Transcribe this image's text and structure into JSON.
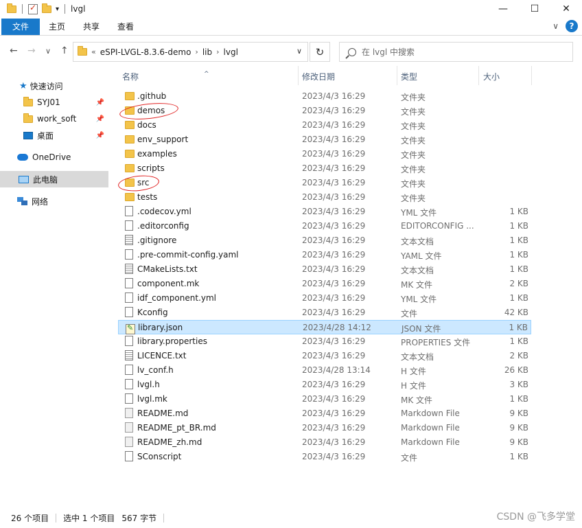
{
  "window": {
    "title": "lvgl",
    "controls": {
      "minimize": "—",
      "maximize": "☐",
      "close": "✕"
    }
  },
  "ribbon": {
    "tabs": [
      "文件",
      "主页",
      "共享",
      "查看"
    ],
    "expand_glyph": "∨",
    "help_glyph": "?"
  },
  "navigation": {
    "back": "←",
    "forward": "→",
    "recent": "∨",
    "up": "↑",
    "breadcrumb_prefix": "«",
    "breadcrumb": [
      "eSPI-LVGL-8.3.6-demo",
      "lib",
      "lvgl"
    ],
    "refresh": "↻",
    "search_placeholder": "在 lvgl 中搜索"
  },
  "sidebar": {
    "quick_access": "快速访问",
    "pinned": [
      "SYJ01",
      "work_soft",
      "桌面"
    ],
    "onedrive": "OneDrive",
    "this_pc": "此电脑",
    "network": "网络"
  },
  "columns": {
    "name": "名称",
    "modified": "修改日期",
    "type": "类型",
    "size": "大小"
  },
  "files": [
    {
      "icon": "folder",
      "name": ".github",
      "date": "2023/4/3 16:29",
      "type": "文件夹",
      "size": ""
    },
    {
      "icon": "folder",
      "name": "demos",
      "date": "2023/4/3 16:29",
      "type": "文件夹",
      "size": ""
    },
    {
      "icon": "folder",
      "name": "docs",
      "date": "2023/4/3 16:29",
      "type": "文件夹",
      "size": ""
    },
    {
      "icon": "folder",
      "name": "env_support",
      "date": "2023/4/3 16:29",
      "type": "文件夹",
      "size": ""
    },
    {
      "icon": "folder",
      "name": "examples",
      "date": "2023/4/3 16:29",
      "type": "文件夹",
      "size": ""
    },
    {
      "icon": "folder",
      "name": "scripts",
      "date": "2023/4/3 16:29",
      "type": "文件夹",
      "size": ""
    },
    {
      "icon": "folder",
      "name": "src",
      "date": "2023/4/3 16:29",
      "type": "文件夹",
      "size": ""
    },
    {
      "icon": "folder",
      "name": "tests",
      "date": "2023/4/3 16:29",
      "type": "文件夹",
      "size": ""
    },
    {
      "icon": "doc",
      "name": ".codecov.yml",
      "date": "2023/4/3 16:29",
      "type": "YML 文件",
      "size": "1 KB"
    },
    {
      "icon": "doc",
      "name": ".editorconfig",
      "date": "2023/4/3 16:29",
      "type": "EDITORCONFIG ...",
      "size": "1 KB"
    },
    {
      "icon": "txt",
      "name": ".gitignore",
      "date": "2023/4/3 16:29",
      "type": "文本文档",
      "size": "1 KB"
    },
    {
      "icon": "doc",
      "name": ".pre-commit-config.yaml",
      "date": "2023/4/3 16:29",
      "type": "YAML 文件",
      "size": "1 KB"
    },
    {
      "icon": "txt",
      "name": "CMakeLists.txt",
      "date": "2023/4/3 16:29",
      "type": "文本文档",
      "size": "1 KB"
    },
    {
      "icon": "doc",
      "name": "component.mk",
      "date": "2023/4/3 16:29",
      "type": "MK 文件",
      "size": "2 KB"
    },
    {
      "icon": "doc",
      "name": "idf_component.yml",
      "date": "2023/4/3 16:29",
      "type": "YML 文件",
      "size": "1 KB"
    },
    {
      "icon": "doc",
      "name": "Kconfig",
      "date": "2023/4/3 16:29",
      "type": "文件",
      "size": "42 KB"
    },
    {
      "icon": "json",
      "name": "library.json",
      "date": "2023/4/28 14:12",
      "type": "JSON 文件",
      "size": "1 KB",
      "selected": true
    },
    {
      "icon": "doc",
      "name": "library.properties",
      "date": "2023/4/3 16:29",
      "type": "PROPERTIES 文件",
      "size": "1 KB"
    },
    {
      "icon": "txt",
      "name": "LICENCE.txt",
      "date": "2023/4/3 16:29",
      "type": "文本文档",
      "size": "2 KB"
    },
    {
      "icon": "doc",
      "name": "lv_conf.h",
      "date": "2023/4/28 13:14",
      "type": "H 文件",
      "size": "26 KB"
    },
    {
      "icon": "doc",
      "name": "lvgl.h",
      "date": "2023/4/3 16:29",
      "type": "H 文件",
      "size": "3 KB"
    },
    {
      "icon": "doc",
      "name": "lvgl.mk",
      "date": "2023/4/3 16:29",
      "type": "MK 文件",
      "size": "1 KB"
    },
    {
      "icon": "md",
      "name": "README.md",
      "date": "2023/4/3 16:29",
      "type": "Markdown File",
      "size": "9 KB"
    },
    {
      "icon": "md",
      "name": "README_pt_BR.md",
      "date": "2023/4/3 16:29",
      "type": "Markdown File",
      "size": "9 KB"
    },
    {
      "icon": "md",
      "name": "README_zh.md",
      "date": "2023/4/3 16:29",
      "type": "Markdown File",
      "size": "9 KB"
    },
    {
      "icon": "doc",
      "name": "SConscript",
      "date": "2023/4/3 16:29",
      "type": "文件",
      "size": "1 KB"
    }
  ],
  "status": {
    "item_count": "26 个项目",
    "selected": "选中 1 个项目",
    "selected_size": "567 字节"
  },
  "watermark": "CSDN @飞多学堂"
}
